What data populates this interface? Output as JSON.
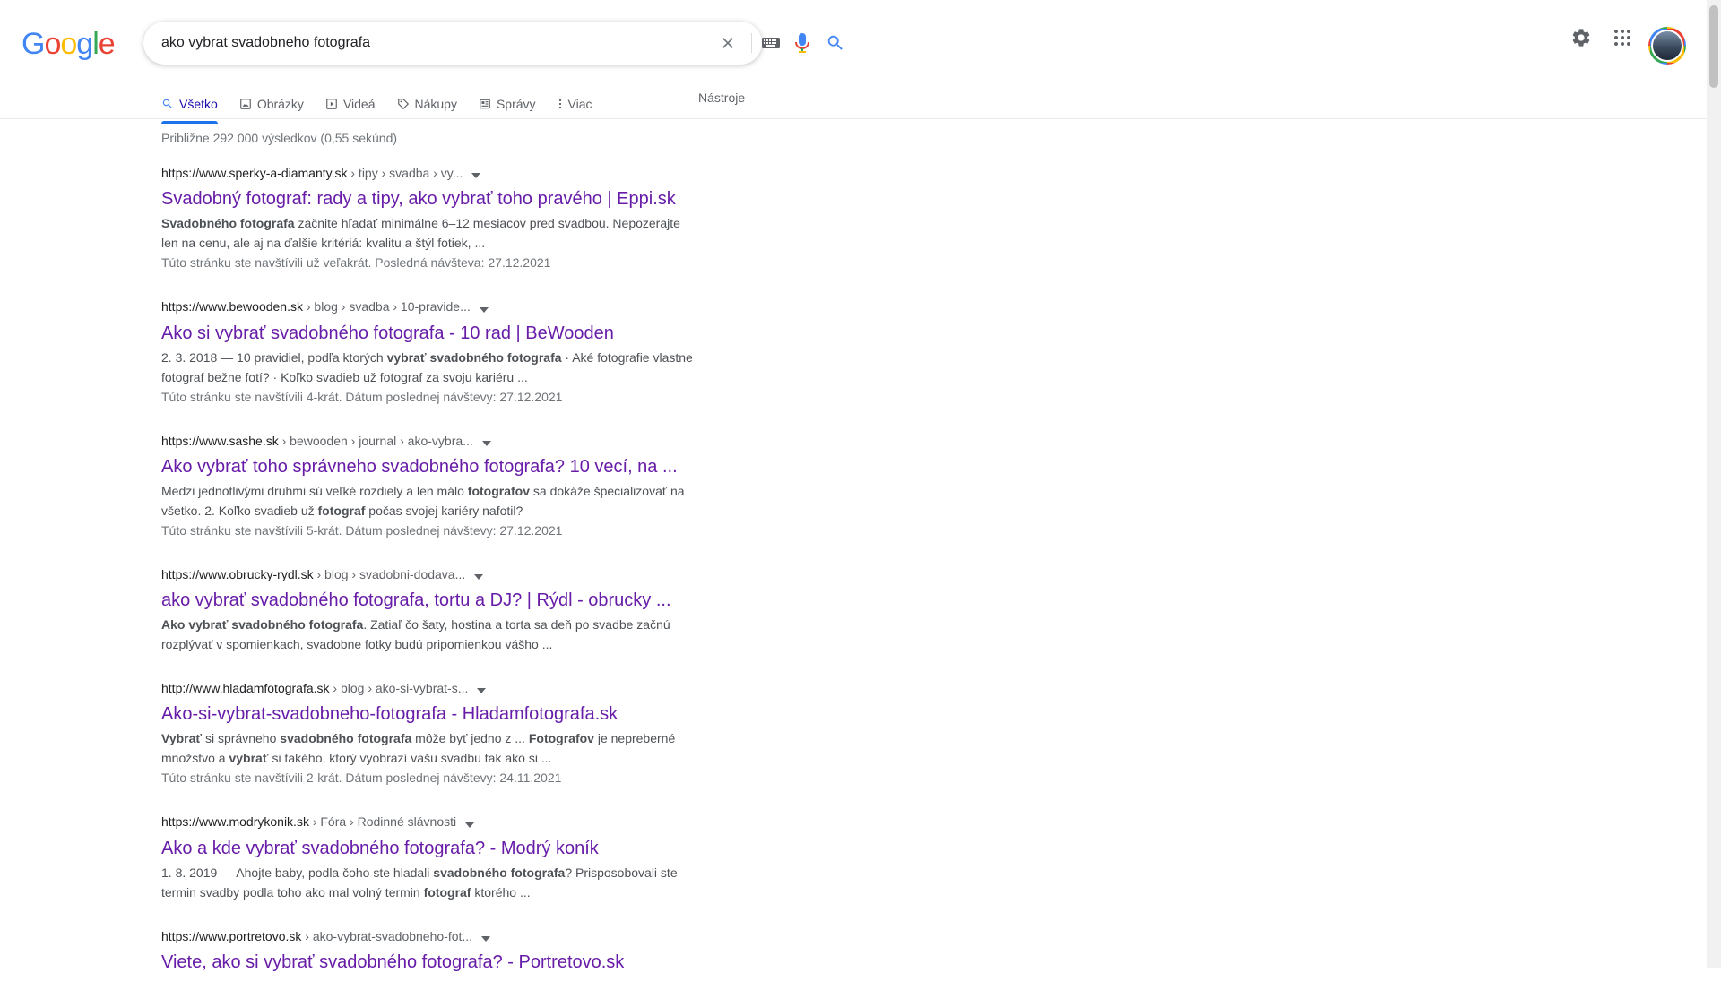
{
  "logo": {
    "letters": [
      {
        "ch": "G",
        "color": "#4285F4"
      },
      {
        "ch": "o",
        "color": "#EA4335"
      },
      {
        "ch": "o",
        "color": "#FBBC05"
      },
      {
        "ch": "g",
        "color": "#4285F4"
      },
      {
        "ch": "l",
        "color": "#34A853"
      },
      {
        "ch": "e",
        "color": "#EA4335"
      }
    ]
  },
  "search": {
    "query": "ako vybrat svadobneho fotografa"
  },
  "icons": {
    "clear": "close-icon",
    "keyboard": "keyboard-icon",
    "mic": "mic-icon",
    "search": "search-icon",
    "settings": "gear-icon",
    "apps": "apps-grid-icon"
  },
  "tabs": [
    {
      "label": "Všetko",
      "icon": "search-icon",
      "active": true
    },
    {
      "label": "Obrázky",
      "icon": "image-icon"
    },
    {
      "label": "Videá",
      "icon": "video-icon"
    },
    {
      "label": "Nákupy",
      "icon": "tag-icon"
    },
    {
      "label": "Správy",
      "icon": "news-icon"
    },
    {
      "label": "Viac",
      "icon": "more-vert-icon"
    }
  ],
  "tools_label": "Nástroje",
  "stats": "Približne 292 000 výsledkov (0,55 sekúnd)",
  "colors": {
    "title_visited": "#681da8",
    "accent": "#1a73e8"
  },
  "results": [
    {
      "site": "https://www.sperky-a-diamanty.sk",
      "path": " › tipy › svadba › vy...",
      "title": "Svadobný fotograf: rady a tipy, ako vybrať toho pravého | Eppi.sk",
      "snippet": [
        {
          "b": true,
          "t": "Svadobného fotografa"
        },
        {
          "t": " začnite hľadať minimálne 6–12 mesiacov pred svadbou. Nepozerajte len na cenu, ale aj na ďalšie kritériá: kvalitu a štýl fotiek, ..."
        }
      ],
      "visited": "Túto stránku ste navštívili už veľakrát. Posledná návšteva: 27.12.2021"
    },
    {
      "site": "https://www.bewooden.sk",
      "path": " › blog › svadba › 10-pravide...",
      "title": "Ako si vybrať svadobného fotografa - 10 rad | BeWooden",
      "snippet": [
        {
          "t": "2. 3. 2018 — 10 pravidiel, podľa ktorých "
        },
        {
          "b": true,
          "t": "vybrať svadobného fotografa"
        },
        {
          "t": " · Aké fotografie vlastne fotograf bežne fotí? · Koľko svadieb už fotograf za svoju kariéru ..."
        }
      ],
      "visited": "Túto stránku ste navštívili 4-krát. Dátum poslednej návštevy: 27.12.2021"
    },
    {
      "site": "https://www.sashe.sk",
      "path": " › bewooden › journal › ako-vybra...",
      "title": "Ako vybrať toho správneho svadobného fotografa? 10 vecí, na ...",
      "snippet": [
        {
          "t": "Medzi jednotlivými druhmi sú veľké rozdiely a len málo "
        },
        {
          "b": true,
          "t": "fotografov"
        },
        {
          "t": " sa dokáže špecializovať na všetko. 2. Koľko svadieb už "
        },
        {
          "b": true,
          "t": "fotograf"
        },
        {
          "t": " počas svojej kariéry nafotil?"
        }
      ],
      "visited": "Túto stránku ste navštívili 5-krát. Dátum poslednej návštevy: 27.12.2021"
    },
    {
      "site": "https://www.obrucky-rydl.sk",
      "path": " › blog › svadobni-dodava...",
      "title": "ako vybrať svadobného fotografa, tortu a DJ? | Rýdl - obrucky ...",
      "snippet": [
        {
          "b": true,
          "t": "Ako vybrať svadobného fotografa"
        },
        {
          "t": ". Zatiaľ čo šaty, hostina a torta sa deň po svadbe začnú rozplývať v spomienkach, svadobne fotky budú pripomienkou vášho ..."
        }
      ],
      "visited": ""
    },
    {
      "site": "http://www.hladamfotografa.sk",
      "path": " › blog › ako-si-vybrat-s...",
      "title": "Ako-si-vybrat-svadobneho-fotografa - Hladamfotografa.sk",
      "snippet": [
        {
          "b": true,
          "t": "Vybrať"
        },
        {
          "t": " si správneho "
        },
        {
          "b": true,
          "t": "svadobného fotografa"
        },
        {
          "t": " môže byť jedno z ... "
        },
        {
          "b": true,
          "t": "Fotografov"
        },
        {
          "t": " je nepreberné množstvo a "
        },
        {
          "b": true,
          "t": "vybrať"
        },
        {
          "t": " si takého, ktorý vyobrazí vašu svadbu tak ako si ..."
        }
      ],
      "visited": "Túto stránku ste navštívili 2-krát. Dátum poslednej návštevy: 24.11.2021"
    },
    {
      "site": "https://www.modrykonik.sk",
      "path": " › Fóra › Rodinné slávnosti",
      "title": "Ako a kde vybrať svadobného fotografa? - Modrý koník",
      "snippet": [
        {
          "t": "1. 8. 2019 — Ahojte baby, podla čoho ste hladali "
        },
        {
          "b": true,
          "t": "svadobného fotografa"
        },
        {
          "t": "? Prisposobovali ste termin svadby podla toho ako mal volný termin "
        },
        {
          "b": true,
          "t": "fotograf"
        },
        {
          "t": " ktorého ..."
        }
      ],
      "visited": ""
    },
    {
      "site": "https://www.portretovo.sk",
      "path": " › ako-vybrat-svadobneho-fot...",
      "title": "Viete, ako si vybrať svadobného fotografa? - Portretovo.sk",
      "snippet": [],
      "visited": ""
    }
  ]
}
